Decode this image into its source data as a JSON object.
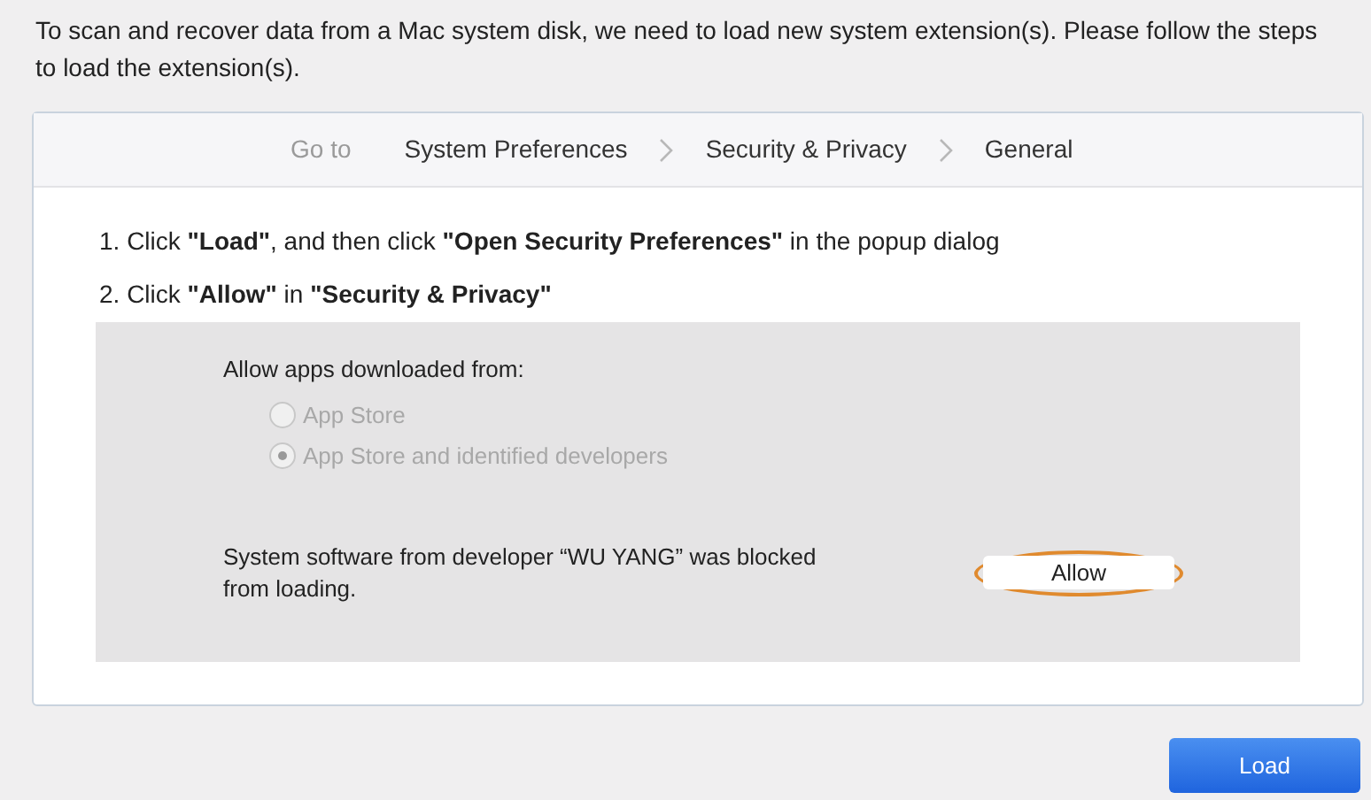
{
  "intro": "To scan and recover data from a Mac system disk, we need to load new system extension(s). Please follow the steps to load the extension(s).",
  "breadcrumb": {
    "prefix": "Go to",
    "items": [
      "System Preferences",
      "Security & Privacy",
      "General"
    ]
  },
  "steps": [
    "1. Click **\"Load\"**, and then click **\"Open Security Preferences\"** in the popup dialog",
    "2. Click **\"Allow\"** in **\"Security & Privacy\"**"
  ],
  "preview": {
    "heading": "Allow apps downloaded from:",
    "options": [
      {
        "label": "App Store",
        "selected": false,
        "disabled": true
      },
      {
        "label": "App Store and identified developers",
        "selected": true,
        "disabled": true
      }
    ],
    "message": "System software from developer “WU YANG” was blocked from loading.",
    "allow_button": {
      "label": "Allow",
      "highlighted": true
    }
  },
  "load_button": "Load"
}
